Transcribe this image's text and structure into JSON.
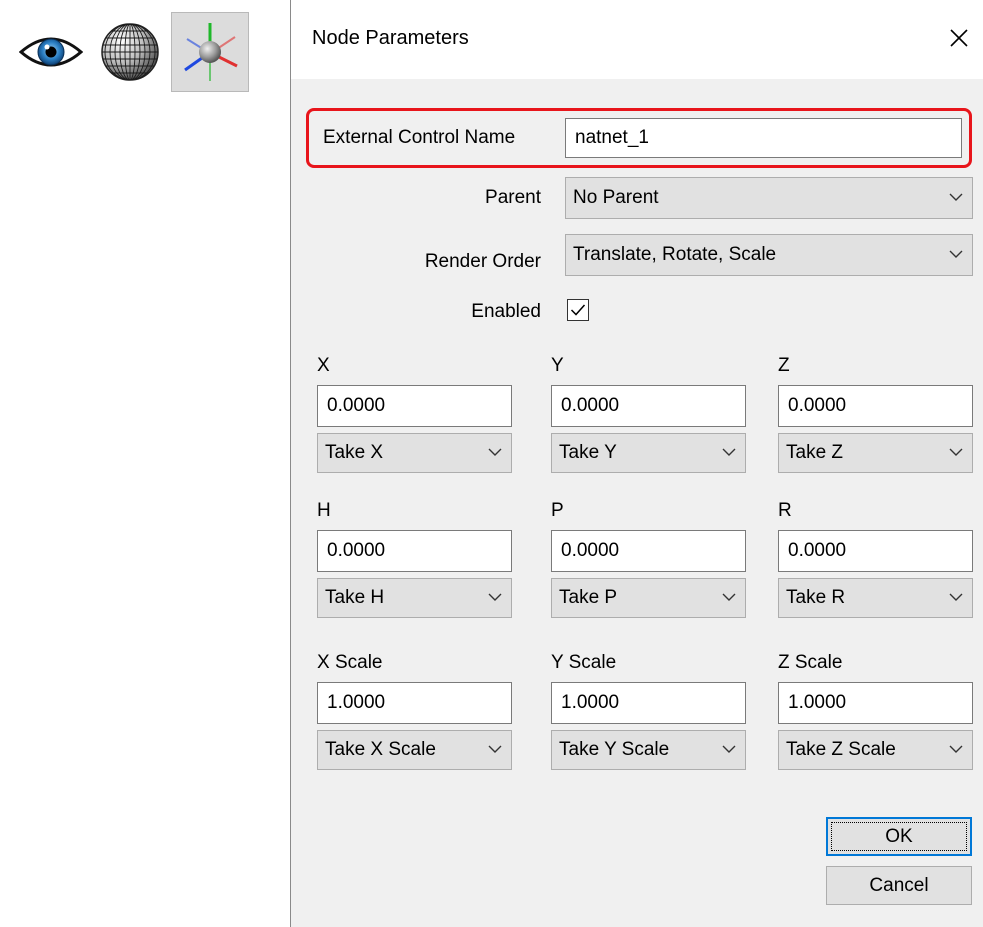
{
  "toolbar": {
    "icons": [
      "eye-icon",
      "wireframe-sphere-icon",
      "transform-axes-icon"
    ],
    "active": "transform-axes-icon"
  },
  "dialog": {
    "title": "Node Parameters",
    "external_control_label": "External Control Name",
    "external_control_value": "natnet_1",
    "parent_label": "Parent",
    "parent_value": "No Parent",
    "render_order_label": "Render Order",
    "render_order_value": "Translate, Rotate, Scale",
    "enabled_label": "Enabled",
    "enabled_checked": true,
    "fields": [
      {
        "label": "X",
        "value": "0.0000",
        "mode": "Take X"
      },
      {
        "label": "Y",
        "value": "0.0000",
        "mode": "Take Y"
      },
      {
        "label": "Z",
        "value": "0.0000",
        "mode": "Take Z"
      },
      {
        "label": "H",
        "value": "0.0000",
        "mode": "Take H"
      },
      {
        "label": "P",
        "value": "0.0000",
        "mode": "Take P"
      },
      {
        "label": "R",
        "value": "0.0000",
        "mode": "Take R"
      },
      {
        "label": "X Scale",
        "value": "1.0000",
        "mode": "Take X Scale"
      },
      {
        "label": "Y Scale",
        "value": "1.0000",
        "mode": "Take Y Scale"
      },
      {
        "label": "Z Scale",
        "value": "1.0000",
        "mode": "Take Z Scale"
      }
    ],
    "ok_label": "OK",
    "cancel_label": "Cancel"
  },
  "colors": {
    "highlight": "#e8151b",
    "dialog_bg": "#f0f0f0",
    "focus": "#0078d7"
  }
}
